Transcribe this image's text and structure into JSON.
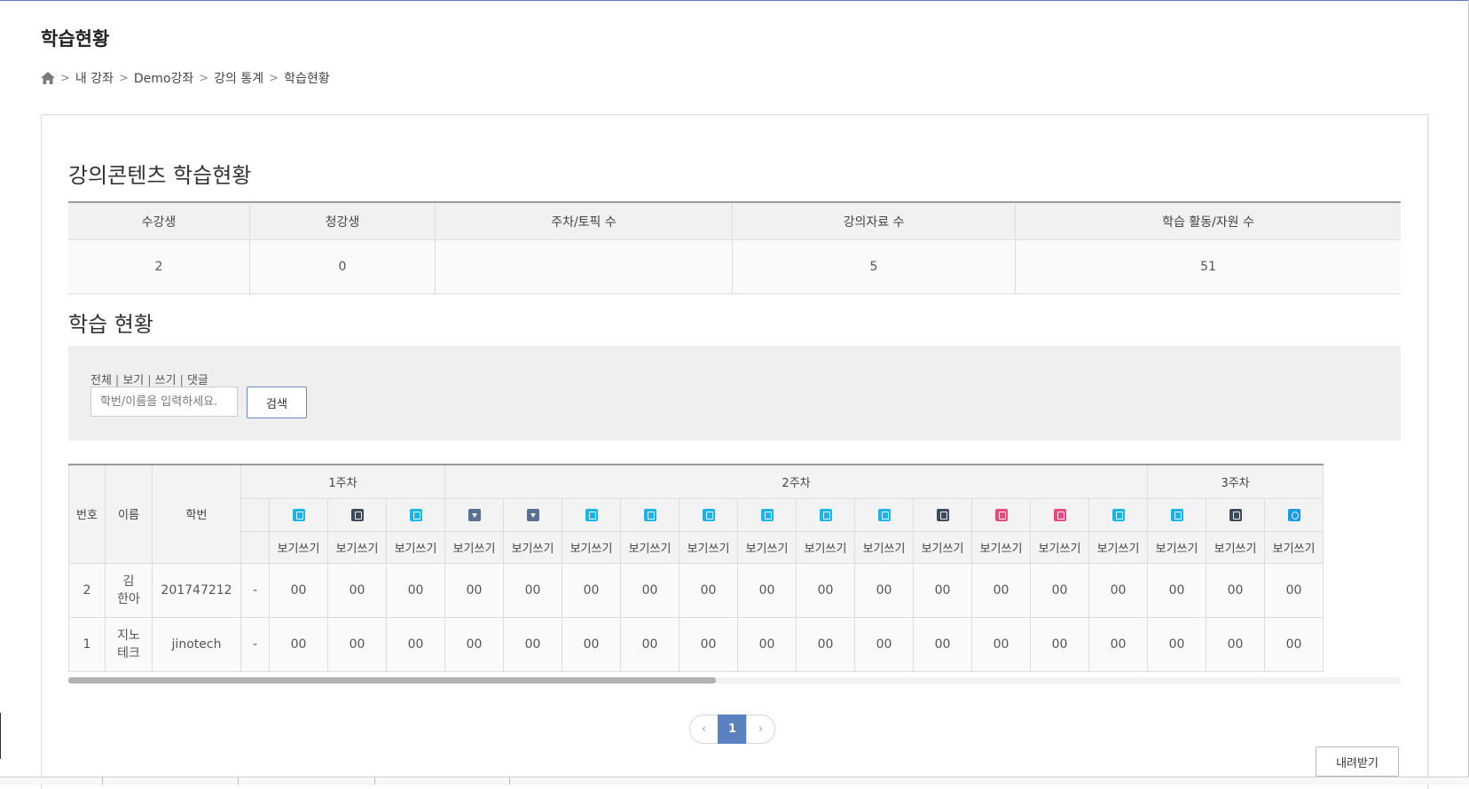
{
  "page": {
    "title": "학습현황"
  },
  "breadcrumb": {
    "items": [
      "내 강좌",
      "Demo강좌",
      "강의 통계",
      "학습현황"
    ]
  },
  "summary": {
    "heading": "강의콘텐츠 학습현황",
    "headers": [
      "수강생",
      "청강생",
      "주차/토픽 수",
      "강의자료 수",
      "학습 활동/자원 수"
    ],
    "values": [
      "2",
      "0",
      "",
      "5",
      "51"
    ]
  },
  "status": {
    "heading": "학습 현황",
    "filters": [
      "전체",
      "보기",
      "쓰기",
      "댓글"
    ],
    "search_placeholder": "학번/이름을 입력하세요.",
    "search_button": "검색"
  },
  "grid": {
    "headers": {
      "no": "번호",
      "name": "이름",
      "id": "학번"
    },
    "weeks": [
      {
        "label": "1주차",
        "span": 4
      },
      {
        "label": "2주차",
        "span": 12
      },
      {
        "label": "3주차",
        "span": 3
      }
    ],
    "activity_icons": [
      {
        "name": "assignment-icon",
        "color": "#1ab4e8"
      },
      {
        "name": "file-icon",
        "color": "#3d4a5c"
      },
      {
        "name": "assignment-icon",
        "color": "#1ab4e8"
      },
      {
        "name": "download-icon",
        "color": "#5a6f94"
      },
      {
        "name": "download-icon",
        "color": "#5a6f94"
      },
      {
        "name": "assignment-icon",
        "color": "#1ab4e8"
      },
      {
        "name": "assignment-icon",
        "color": "#1ab4e8"
      },
      {
        "name": "assignment-icon",
        "color": "#1ab4e8"
      },
      {
        "name": "assignment-icon",
        "color": "#1ab4e8"
      },
      {
        "name": "assignment-icon",
        "color": "#1ab4e8"
      },
      {
        "name": "assignment-icon",
        "color": "#1ab4e8"
      },
      {
        "name": "file-icon",
        "color": "#3d4a5c"
      },
      {
        "name": "pdf-icon",
        "color": "#e84a7f"
      },
      {
        "name": "pdf-icon",
        "color": "#e84a7f"
      },
      {
        "name": "assignment-icon",
        "color": "#1ab4e8"
      },
      {
        "name": "assignment-icon",
        "color": "#1ab4e8"
      },
      {
        "name": "file-icon",
        "color": "#3d4a5c"
      },
      {
        "name": "chat-icon",
        "color": "#1a9ae8"
      }
    ],
    "sub_label": "보기쓰기",
    "rows": [
      {
        "no": "2",
        "name": "김\n한아",
        "id": "201747212",
        "first": "-",
        "cells": [
          "00",
          "00",
          "00",
          "00",
          "00",
          "00",
          "00",
          "00",
          "00",
          "00",
          "00",
          "00",
          "00",
          "00",
          "00",
          "00",
          "00",
          "00"
        ]
      },
      {
        "no": "1",
        "name": "지노\n테크",
        "id": "jinotech",
        "first": "-",
        "cells": [
          "00",
          "00",
          "00",
          "00",
          "00",
          "00",
          "00",
          "00",
          "00",
          "00",
          "00",
          "00",
          "00",
          "00",
          "00",
          "00",
          "00",
          "00"
        ]
      }
    ]
  },
  "pagination": {
    "prev": "‹",
    "current": "1",
    "next": "›"
  },
  "download_button": "내려받기"
}
